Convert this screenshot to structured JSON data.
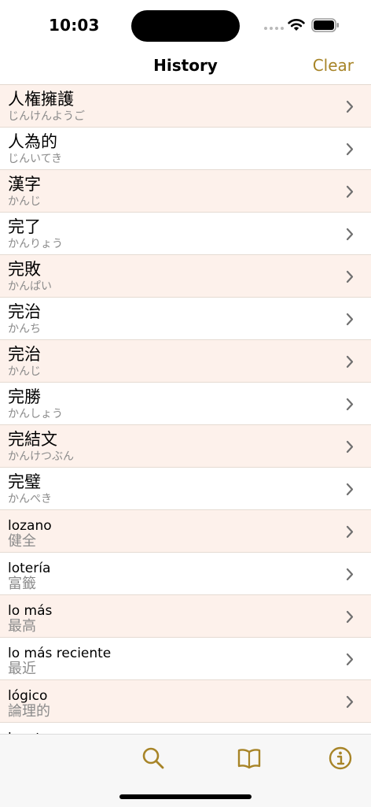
{
  "status": {
    "time": "10:03"
  },
  "nav": {
    "title": "History",
    "clear_label": "Clear"
  },
  "colors": {
    "accent": "#a78427",
    "row_alt": "#fdf1eb",
    "subtitle": "#8b8b8b"
  },
  "icons": {
    "row": "chevron-right-icon",
    "tabs": [
      "search-icon",
      "book-icon",
      "info-icon"
    ]
  },
  "history": [
    {
      "title": "人権擁護",
      "subtitle": "じんけんようご"
    },
    {
      "title": "人為的",
      "subtitle": "じんいてき"
    },
    {
      "title": "漢字",
      "subtitle": "かんじ"
    },
    {
      "title": "完了",
      "subtitle": "かんりょう"
    },
    {
      "title": "完敗",
      "subtitle": "かんぱい"
    },
    {
      "title": "完治",
      "subtitle": "かんち"
    },
    {
      "title": "完治",
      "subtitle": "かんじ"
    },
    {
      "title": "完勝",
      "subtitle": "かんしょう"
    },
    {
      "title": "完結文",
      "subtitle": "かんけつぶん"
    },
    {
      "title": "完璧",
      "subtitle": "かんぺき"
    },
    {
      "title": "lozano",
      "subtitle": "健全"
    },
    {
      "title": "lotería",
      "subtitle": "富籤"
    },
    {
      "title": "lo más",
      "subtitle": "最高"
    },
    {
      "title": "lo más reciente",
      "subtitle": "最近"
    },
    {
      "title": "lógico",
      "subtitle": "論理的"
    },
    {
      "title": "locutor",
      "subtitle": ""
    }
  ]
}
